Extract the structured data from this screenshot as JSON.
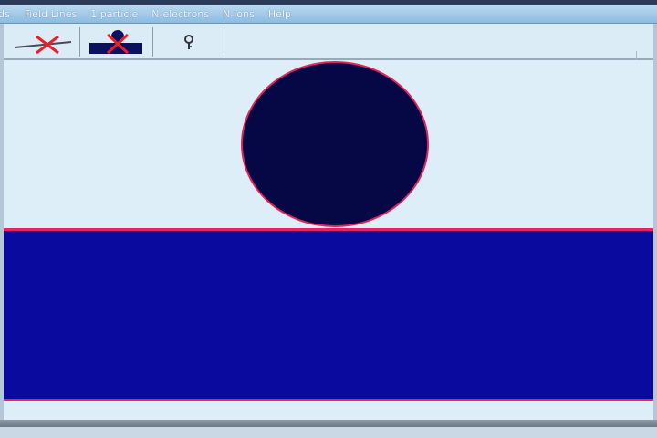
{
  "menu": {
    "items": [
      {
        "label": "ds"
      },
      {
        "label": "Field Lines"
      },
      {
        "label": "1 particle"
      },
      {
        "label": "N-electrons"
      },
      {
        "label": "N-ions"
      },
      {
        "label": "Help"
      }
    ]
  },
  "toolbar": {
    "buttons": [
      {
        "icon": "line-delete-icon"
      },
      {
        "icon": "object-delete-icon"
      },
      {
        "icon": "key-icon"
      }
    ]
  },
  "colors": {
    "background": "#ddeef8",
    "sphere": "#050845",
    "plate": "#0a0a9e",
    "outline": "#e5235f",
    "delete_mark": "#e8202a"
  }
}
